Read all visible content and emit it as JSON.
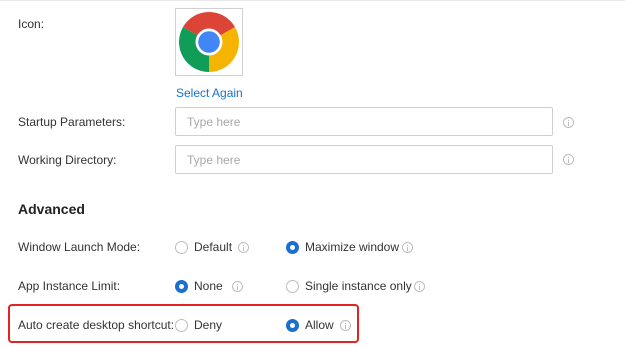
{
  "fields": {
    "icon_label": "Icon:",
    "select_again": "Select Again",
    "startup": {
      "label": "Startup Parameters:",
      "placeholder": "Type here",
      "value": ""
    },
    "working_dir": {
      "label": "Working Directory:",
      "placeholder": "Type here",
      "value": ""
    }
  },
  "advanced": {
    "heading": "Advanced",
    "launch_mode": {
      "label": "Window Launch Mode:",
      "options": [
        "Default",
        "Maximize window"
      ],
      "selected": "Maximize window"
    },
    "instance_limit": {
      "label": "App Instance Limit:",
      "options": [
        "None",
        "Single instance only"
      ],
      "selected": "None"
    },
    "desktop_shortcut": {
      "label": "Auto create desktop shortcut:",
      "options": [
        "Deny",
        "Allow"
      ],
      "selected": "Allow"
    }
  },
  "icon": {
    "name": "chrome-logo-icon",
    "colors": [
      "#db4437",
      "#f4b400",
      "#0f9d58",
      "#4285f4"
    ]
  },
  "colors": {
    "accent": "#1a6fd1",
    "link": "#1a73c8",
    "highlight": "#e02424"
  }
}
